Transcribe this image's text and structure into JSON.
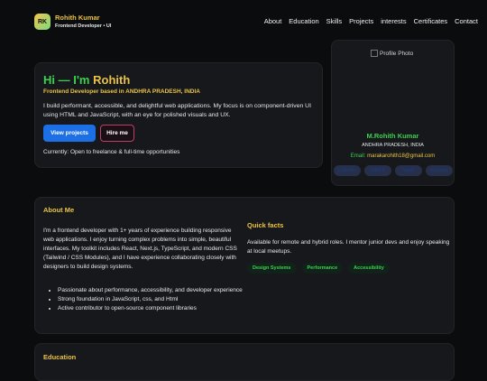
{
  "header": {
    "logo_initials": "RK",
    "name": "Rohith Kumar",
    "role": "Frontend Developer • UI",
    "nav": [
      "About",
      "Education",
      "Skills",
      "Projects",
      "interests",
      "Certificates",
      "Contact"
    ]
  },
  "hero": {
    "greeting": "Hi — I'm ",
    "greeting_name": "Rohith",
    "subtitle": "Frontend Developer based in ANDHRA PRADESH, INDIA",
    "intro": "I build performant, accessible, and delightful web applications. My focus is on component-driven UI using HTML and JavaScript, with an eye for polished visuals and UX.",
    "primary_button": "View projects",
    "secondary_button": "Hire me",
    "availability": "Currently: Open to freelance & full-time opportunities"
  },
  "profile": {
    "photo_alt": "Profile Photo",
    "name": "M.Rohith Kumar",
    "location": "ANDHRA PRADESH, INDIA",
    "email_label": "Email: ",
    "email": "marakarohith18@gmail.com",
    "socials": [
      "LinkedIn",
      "GitHub",
      "Twitter",
      "Resume"
    ]
  },
  "about": {
    "title": "About Me",
    "text": "I'm a frontend developer with 1+ years of experience building responsive web applications. I enjoy turning complex problems into simple, beautiful interfaces. My toolkit includes React, Next.js, TypeScript, and modern CSS (Tailwind / CSS Modules), and I have experience collaborating closely with designers to build design systems.",
    "bullets": [
      "Passionate about performance, accessibility, and developer experience",
      "Strong foundation in JavaScript, css, and Html",
      "Active contributor to open-source component libraries"
    ],
    "quick_title": "Quick facts",
    "quick_text": "Available for remote and hybrid roles. I mentor junior devs and enjoy speaking at local meetups.",
    "tags": [
      "Design Systems",
      "Performance",
      "Accessibility"
    ]
  },
  "education": {
    "title": "Education"
  },
  "colors": {
    "accent_green": "#3bd14e",
    "accent_yellow": "#e9c346",
    "primary_blue": "#1d6fe6",
    "secondary_border": "#c23d66",
    "background": "#0b0c0e"
  }
}
